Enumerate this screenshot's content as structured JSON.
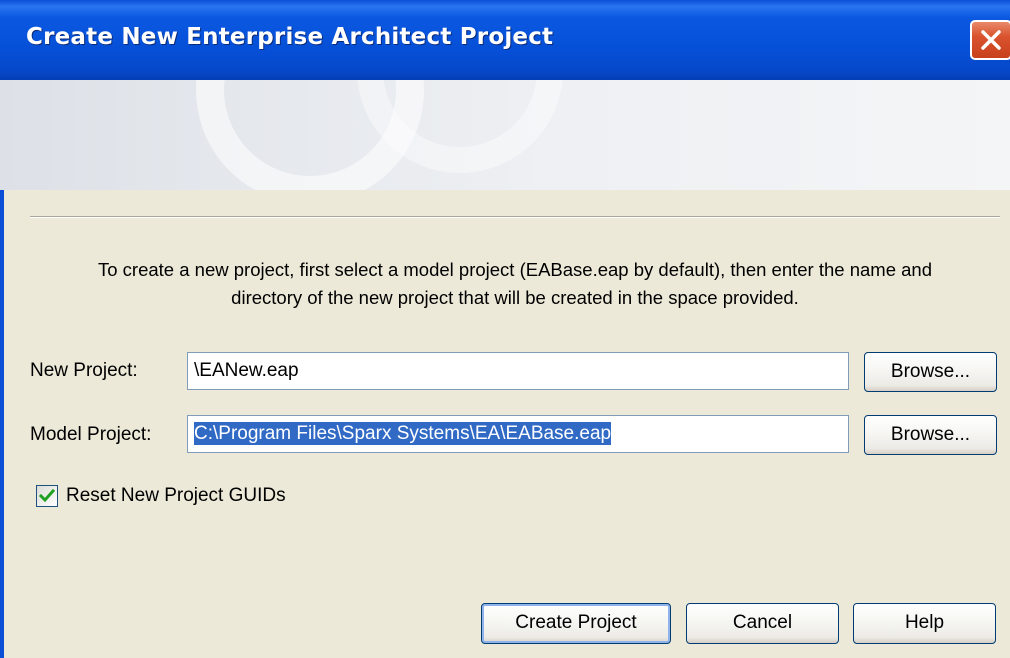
{
  "window": {
    "title": "Create New Enterprise Architect Project",
    "close_icon": "close-x-icon"
  },
  "instructions": {
    "line1": "To create a new project, first select a model project (EABase.eap by default), then enter the name and",
    "line2": "directory of the new project that will be created in the space provided."
  },
  "form": {
    "new_project": {
      "label": "New Project:",
      "value": "\\EANew.eap",
      "browse_label": "Browse..."
    },
    "model_project": {
      "label": "Model Project:",
      "value": "C:\\Program Files\\Sparx Systems\\EA\\EABase.eap",
      "value_selected": true,
      "browse_label": "Browse..."
    },
    "reset_guids": {
      "label": "Reset New Project GUIDs",
      "checked": true
    }
  },
  "buttons": {
    "create_label": "Create Project",
    "cancel_label": "Cancel",
    "help_label": "Help"
  },
  "colors": {
    "titlebar_blue": "#0650d8",
    "selection_blue": "#316ac5",
    "dialog_face": "#ece9d8",
    "close_red": "#d9542e"
  }
}
